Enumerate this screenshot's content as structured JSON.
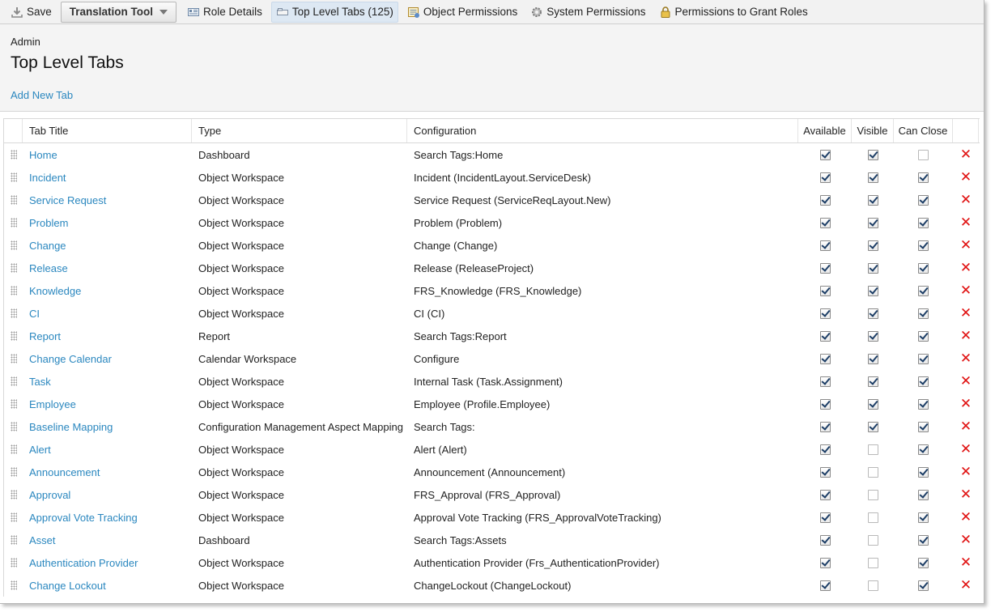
{
  "toolbar": {
    "save_label": "Save",
    "translation_label": "Translation Tool",
    "tabs": [
      {
        "label": "Role Details",
        "icon": "role-details-icon"
      },
      {
        "label": "Top Level Tabs (125)",
        "icon": "tabs-icon",
        "active": true
      },
      {
        "label": "Object Permissions",
        "icon": "object-permissions-icon"
      },
      {
        "label": "System Permissions",
        "icon": "gear-icon"
      },
      {
        "label": "Permissions to Grant Roles",
        "icon": "lock-icon"
      }
    ]
  },
  "header": {
    "breadcrumb": "Admin",
    "title": "Top Level Tabs",
    "add_link": "Add New Tab"
  },
  "grid": {
    "columns": [
      "Tab Title",
      "Type",
      "Configuration",
      "Available",
      "Visible",
      "Can Close"
    ],
    "rows": [
      {
        "title": "Home",
        "type": "Dashboard",
        "config": "Search Tags:Home",
        "available": true,
        "visible": true,
        "can_close": false
      },
      {
        "title": "Incident",
        "type": "Object Workspace",
        "config": "Incident (IncidentLayout.ServiceDesk)",
        "available": true,
        "visible": true,
        "can_close": true
      },
      {
        "title": "Service Request",
        "type": "Object Workspace",
        "config": "Service Request (ServiceReqLayout.New)",
        "available": true,
        "visible": true,
        "can_close": true
      },
      {
        "title": "Problem",
        "type": "Object Workspace",
        "config": "Problem (Problem)",
        "available": true,
        "visible": true,
        "can_close": true
      },
      {
        "title": "Change",
        "type": "Object Workspace",
        "config": "Change (Change)",
        "available": true,
        "visible": true,
        "can_close": true
      },
      {
        "title": "Release",
        "type": "Object Workspace",
        "config": "Release (ReleaseProject)",
        "available": true,
        "visible": true,
        "can_close": true
      },
      {
        "title": "Knowledge",
        "type": "Object Workspace",
        "config": "FRS_Knowledge (FRS_Knowledge)",
        "available": true,
        "visible": true,
        "can_close": true
      },
      {
        "title": "CI",
        "type": "Object Workspace",
        "config": "CI (CI)",
        "available": true,
        "visible": true,
        "can_close": true
      },
      {
        "title": "Report",
        "type": "Report",
        "config": "Search Tags:Report",
        "available": true,
        "visible": true,
        "can_close": true
      },
      {
        "title": "Change Calendar",
        "type": "Calendar Workspace",
        "config": "Configure",
        "available": true,
        "visible": true,
        "can_close": true
      },
      {
        "title": "Task",
        "type": "Object Workspace",
        "config": "Internal Task (Task.Assignment)",
        "available": true,
        "visible": true,
        "can_close": true
      },
      {
        "title": "Employee",
        "type": "Object Workspace",
        "config": "Employee (Profile.Employee)",
        "available": true,
        "visible": true,
        "can_close": true
      },
      {
        "title": "Baseline Mapping",
        "type": "Configuration Management Aspect Mapping",
        "config": "Search Tags:",
        "available": true,
        "visible": true,
        "can_close": true
      },
      {
        "title": "Alert",
        "type": "Object Workspace",
        "config": "Alert (Alert)",
        "available": true,
        "visible": false,
        "can_close": true
      },
      {
        "title": "Announcement",
        "type": "Object Workspace",
        "config": "Announcement (Announcement)",
        "available": true,
        "visible": false,
        "can_close": true
      },
      {
        "title": "Approval",
        "type": "Object Workspace",
        "config": "FRS_Approval (FRS_Approval)",
        "available": true,
        "visible": false,
        "can_close": true
      },
      {
        "title": "Approval Vote Tracking",
        "type": "Object Workspace",
        "config": "Approval Vote Tracking (FRS_ApprovalVoteTracking)",
        "available": true,
        "visible": false,
        "can_close": true
      },
      {
        "title": "Asset",
        "type": "Dashboard",
        "config": "Search Tags:Assets",
        "available": true,
        "visible": false,
        "can_close": true
      },
      {
        "title": "Authentication Provider",
        "type": "Object Workspace",
        "config": "Authentication Provider (Frs_AuthenticationProvider)",
        "available": true,
        "visible": false,
        "can_close": true
      },
      {
        "title": "Change Lockout",
        "type": "Object Workspace",
        "config": "ChangeLockout (ChangeLockout)",
        "available": true,
        "visible": false,
        "can_close": true
      }
    ]
  }
}
